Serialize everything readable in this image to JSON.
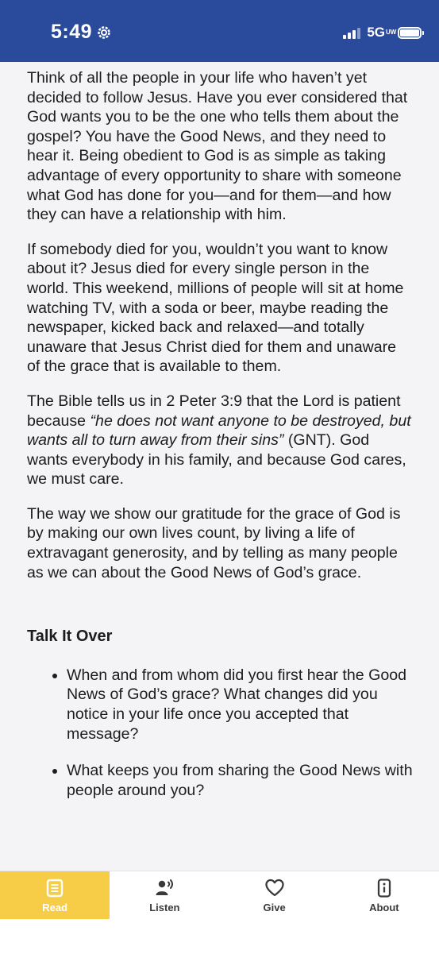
{
  "status_bar": {
    "time": "5:49",
    "network": "5G",
    "network_suffix": "UW",
    "colors": {
      "background": "#2a4a9b"
    }
  },
  "article": {
    "paragraphs": [
      "Think of all the people in your life who haven’t yet decided to follow Jesus. Have you ever considered that God wants you to be the one who tells them about the gospel? You have the Good News, and they need to hear it. Being obedient to God is as simple as taking advantage of every opportunity to share with someone what God has done for you—and for them—and how they can have a relationship with him.",
      "If somebody died for you, wouldn’t you want to know about it? Jesus died for every single person in the world. This weekend, millions of people will sit at home watching TV, with a soda or beer, maybe reading the newspaper, kicked back and relaxed—and totally unaware that Jesus Christ died for them and unaware of the grace that is available to them."
    ],
    "p3": {
      "before": "The Bible tells us in 2 Peter 3:9 that the Lord is patient because ",
      "quote": "“he does not want anyone to be destroyed, but wants all to turn away from their sins”",
      "after": " (GNT). God wants everybody in his family, and because God cares, we must care."
    },
    "p4": "The way we show our gratitude for the grace of God is by making our own lives count, by living a life of extravagant generosity, and by telling as many people as we can about the Good News of God’s grace.",
    "talk_title": "Talk It Over",
    "questions": [
      "When and from whom did you first hear the Good News of God’s grace? What changes did you notice in your life once you accepted that message?",
      "What keeps you from sharing the Good News with people around you?"
    ]
  },
  "tab_bar": {
    "accent": "#f7cc47",
    "tabs": [
      {
        "label": "Read",
        "icon": "book-icon",
        "active": true
      },
      {
        "label": "Listen",
        "icon": "listen-icon",
        "active": false
      },
      {
        "label": "Give",
        "icon": "heart-icon",
        "active": false
      },
      {
        "label": "About",
        "icon": "info-icon",
        "active": false
      }
    ]
  }
}
